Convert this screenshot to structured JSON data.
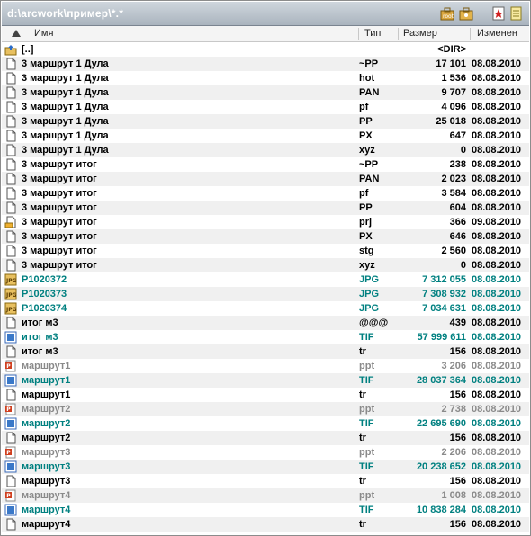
{
  "path": "d:\\arcwork\\пример\\*.*",
  "toolbar": {
    "icons": [
      "toolbox-icon",
      "tools-icon",
      "star-icon",
      "notepad-icon"
    ]
  },
  "columns": {
    "name": "Имя",
    "type": "Тип",
    "size": "Размер",
    "modified": "Изменен"
  },
  "rows": [
    {
      "icon": "up-folder-icon",
      "name": "[..]",
      "ext": "",
      "size": "<DIR>",
      "date": "",
      "color": "black"
    },
    {
      "icon": "file-icon",
      "name": "3 маршрут 1 Дула",
      "ext": "~PP",
      "size": "17 101",
      "date": "08.08.2010",
      "color": "black"
    },
    {
      "icon": "file-icon",
      "name": "3 маршрут 1 Дула",
      "ext": "hot",
      "size": "1 536",
      "date": "08.08.2010",
      "color": "black"
    },
    {
      "icon": "file-icon",
      "name": "3 маршрут 1 Дула",
      "ext": "PAN",
      "size": "9 707",
      "date": "08.08.2010",
      "color": "black"
    },
    {
      "icon": "file-icon",
      "name": "3 маршрут 1 Дула",
      "ext": "pf",
      "size": "4 096",
      "date": "08.08.2010",
      "color": "black"
    },
    {
      "icon": "file-icon",
      "name": "3 маршрут 1 Дула",
      "ext": "PP",
      "size": "25 018",
      "date": "08.08.2010",
      "color": "black"
    },
    {
      "icon": "file-icon",
      "name": "3 маршрут 1 Дула",
      "ext": "PX",
      "size": "647",
      "date": "08.08.2010",
      "color": "black"
    },
    {
      "icon": "file-icon",
      "name": "3 маршрут 1 Дула",
      "ext": "xyz",
      "size": "0",
      "date": "08.08.2010",
      "color": "black"
    },
    {
      "icon": "file-icon",
      "name": "3 маршрут итог",
      "ext": "~PP",
      "size": "238",
      "date": "08.08.2010",
      "color": "black"
    },
    {
      "icon": "file-icon",
      "name": "3 маршрут итог",
      "ext": "PAN",
      "size": "2 023",
      "date": "08.08.2010",
      "color": "black"
    },
    {
      "icon": "file-icon",
      "name": "3 маршрут итог",
      "ext": "pf",
      "size": "3 584",
      "date": "08.08.2010",
      "color": "black"
    },
    {
      "icon": "file-icon",
      "name": "3 маршрут итог",
      "ext": "PP",
      "size": "604",
      "date": "08.08.2010",
      "color": "black"
    },
    {
      "icon": "project-file-icon",
      "name": "3 маршрут итог",
      "ext": "prj",
      "size": "366",
      "date": "09.08.2010",
      "color": "black"
    },
    {
      "icon": "file-icon",
      "name": "3 маршрут итог",
      "ext": "PX",
      "size": "646",
      "date": "08.08.2010",
      "color": "black"
    },
    {
      "icon": "file-icon",
      "name": "3 маршрут итог",
      "ext": "stg",
      "size": "2 560",
      "date": "08.08.2010",
      "color": "black"
    },
    {
      "icon": "file-icon",
      "name": "3 маршрут итог",
      "ext": "xyz",
      "size": "0",
      "date": "08.08.2010",
      "color": "black"
    },
    {
      "icon": "jpg-icon",
      "name": "P1020372",
      "ext": "JPG",
      "size": "7 312 055",
      "date": "08.08.2010",
      "color": "teal"
    },
    {
      "icon": "jpg-icon",
      "name": "P1020373",
      "ext": "JPG",
      "size": "7 308 932",
      "date": "08.08.2010",
      "color": "teal"
    },
    {
      "icon": "jpg-icon",
      "name": "P1020374",
      "ext": "JPG",
      "size": "7 034 631",
      "date": "08.08.2010",
      "color": "teal"
    },
    {
      "icon": "file-icon",
      "name": "итог м3",
      "ext": "@@@",
      "size": "439",
      "date": "08.08.2010",
      "color": "black"
    },
    {
      "icon": "tif-icon",
      "name": "итог м3",
      "ext": "TIF",
      "size": "57 999 611",
      "date": "08.08.2010",
      "color": "teal"
    },
    {
      "icon": "file-icon",
      "name": "итог м3",
      "ext": "tr",
      "size": "156",
      "date": "08.08.2010",
      "color": "black"
    },
    {
      "icon": "ppt-icon",
      "name": "маршрут1",
      "ext": "ppt",
      "size": "3 206",
      "date": "08.08.2010",
      "color": "gray"
    },
    {
      "icon": "tif-icon",
      "name": "маршрут1",
      "ext": "TIF",
      "size": "28 037 364",
      "date": "08.08.2010",
      "color": "teal"
    },
    {
      "icon": "file-icon",
      "name": "маршрут1",
      "ext": "tr",
      "size": "156",
      "date": "08.08.2010",
      "color": "black"
    },
    {
      "icon": "ppt-icon",
      "name": "маршрут2",
      "ext": "ppt",
      "size": "2 738",
      "date": "08.08.2010",
      "color": "gray"
    },
    {
      "icon": "tif-icon",
      "name": "маршрут2",
      "ext": "TIF",
      "size": "22 695 690",
      "date": "08.08.2010",
      "color": "teal"
    },
    {
      "icon": "file-icon",
      "name": "маршрут2",
      "ext": "tr",
      "size": "156",
      "date": "08.08.2010",
      "color": "black"
    },
    {
      "icon": "ppt-icon",
      "name": "маршрут3",
      "ext": "ppt",
      "size": "2 206",
      "date": "08.08.2010",
      "color": "gray"
    },
    {
      "icon": "tif-icon",
      "name": "маршрут3",
      "ext": "TIF",
      "size": "20 238 652",
      "date": "08.08.2010",
      "color": "teal"
    },
    {
      "icon": "file-icon",
      "name": "маршрут3",
      "ext": "tr",
      "size": "156",
      "date": "08.08.2010",
      "color": "black"
    },
    {
      "icon": "ppt-icon",
      "name": "маршрут4",
      "ext": "ppt",
      "size": "1 008",
      "date": "08.08.2010",
      "color": "gray"
    },
    {
      "icon": "tif-icon",
      "name": "маршрут4",
      "ext": "TIF",
      "size": "10 838 284",
      "date": "08.08.2010",
      "color": "teal"
    },
    {
      "icon": "file-icon",
      "name": "маршрут4",
      "ext": "tr",
      "size": "156",
      "date": "08.08.2010",
      "color": "black"
    }
  ]
}
